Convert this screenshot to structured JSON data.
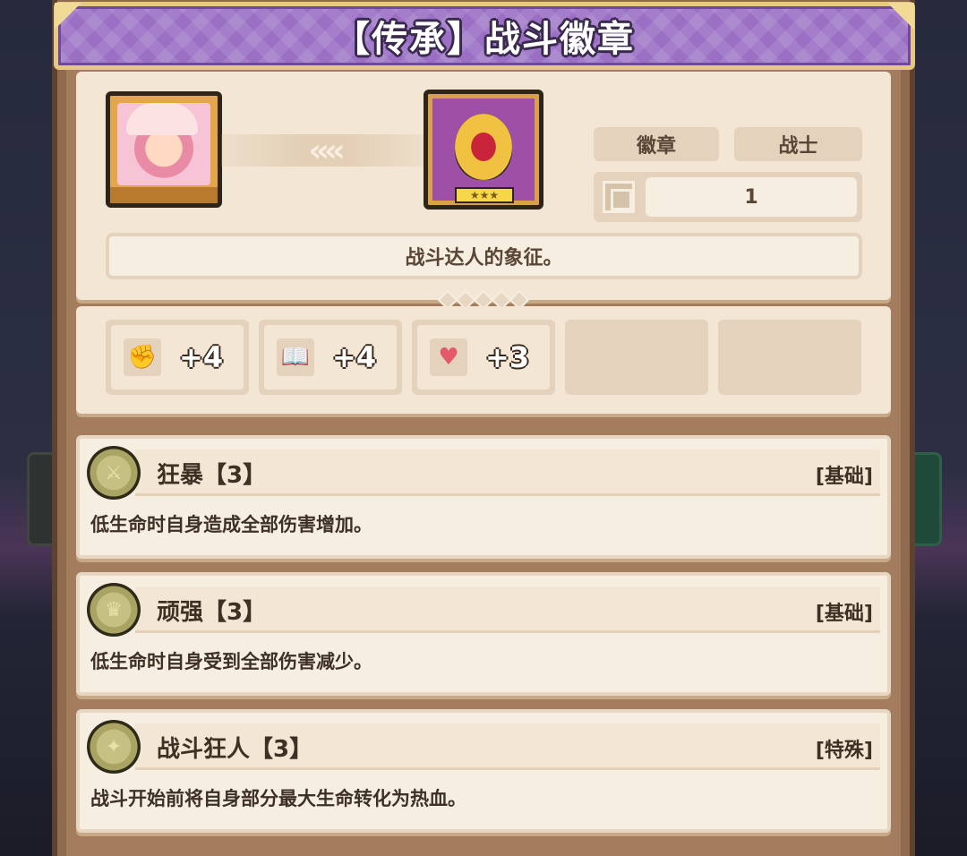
{
  "title": "【传承】战斗徽章",
  "item": {
    "tags": [
      "徽章",
      "战士"
    ],
    "count": "1",
    "description": "战斗达人的象征。",
    "arrow_glyph": "‹‹‹‹"
  },
  "stats": [
    {
      "icon": "fist-icon",
      "value": "+4"
    },
    {
      "icon": "book-icon",
      "value": "+4"
    },
    {
      "icon": "heart-icon",
      "value": "+3"
    }
  ],
  "skills": [
    {
      "name": "狂暴【3】",
      "type": "[基础]",
      "description": "低生命时自身造成全部伤害增加。",
      "icon": "sword-medal-icon"
    },
    {
      "name": "顽强【3】",
      "type": "[基础]",
      "description": "低生命时自身受到全部伤害减少。",
      "icon": "shield-medal-icon"
    },
    {
      "name": "战斗狂人【3】",
      "type": "[特殊]",
      "description": "战斗开始前将自身部分最大生命转化为热血。",
      "icon": "flame-medal-icon"
    }
  ]
}
